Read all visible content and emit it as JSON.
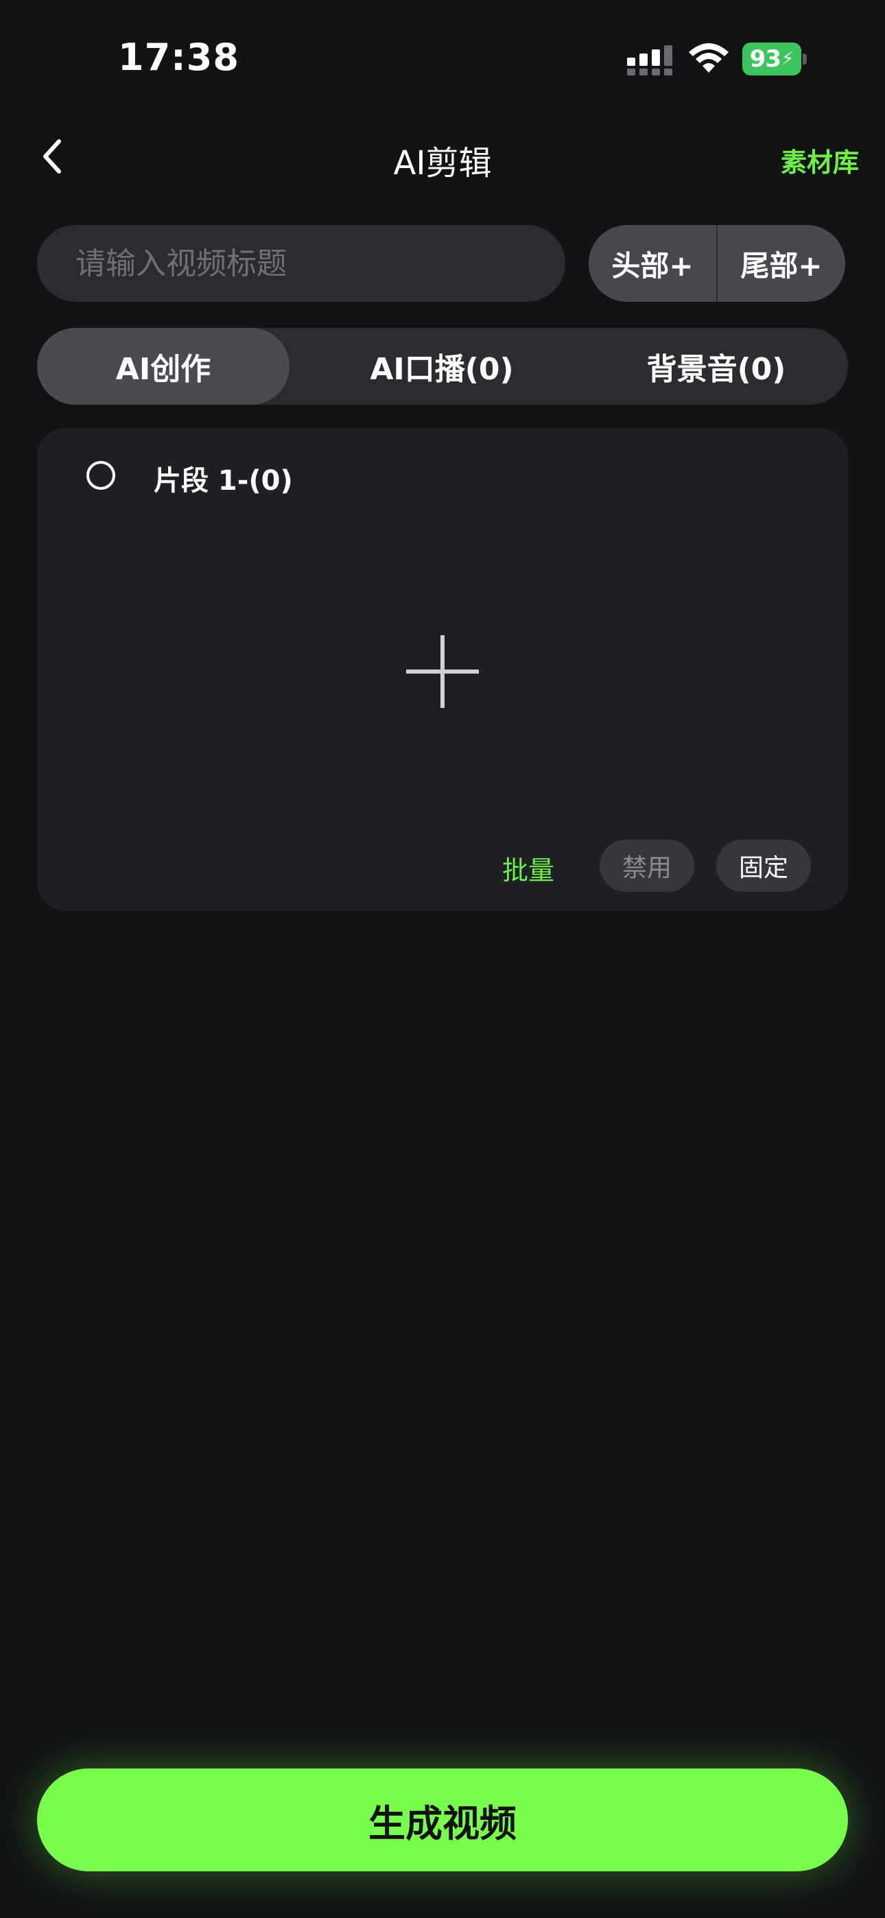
{
  "status_bar": {
    "time": "17:38",
    "battery": "93",
    "battery_color": "#3cc45f"
  },
  "nav": {
    "back_icon": "chevron-left-icon",
    "title": "AI剪辑",
    "library_label": "素材库"
  },
  "title_input": {
    "placeholder": "请输入视频标题",
    "value": ""
  },
  "head_tail": {
    "head_label": "头部+",
    "tail_label": "尾部+"
  },
  "tabs": [
    {
      "label": "AI创作",
      "active": true
    },
    {
      "label": "AI口播(0)",
      "active": false
    },
    {
      "label": "背景音(0)",
      "active": false
    }
  ],
  "segment": {
    "label": "片段 1-(0)",
    "add_icon": "plus-icon",
    "batch_label": "批量",
    "disable_label": "禁用",
    "fix_label": "固定"
  },
  "generate_button": {
    "label": "生成视频"
  },
  "colors": {
    "accent": "#78fe4c",
    "accent_text": "#6ff049",
    "background": "#121315",
    "card": "#1f2024"
  }
}
